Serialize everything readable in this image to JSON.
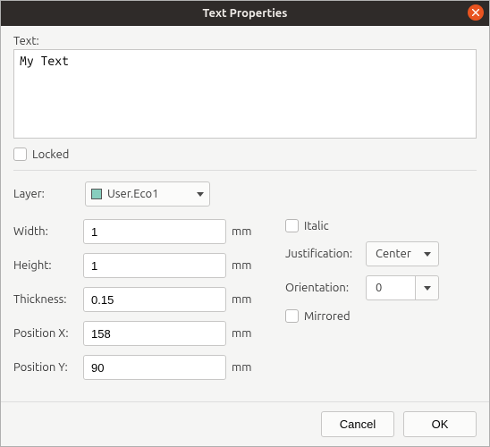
{
  "window": {
    "title": "Text Properties"
  },
  "text": {
    "label": "Text:",
    "value": "My Text"
  },
  "locked": {
    "label": "Locked"
  },
  "layer": {
    "label": "Layer:",
    "value": "User.Eco1",
    "swatch": "#87cebe"
  },
  "fields": {
    "width": {
      "label": "Width:",
      "value": "1",
      "unit": "mm"
    },
    "height": {
      "label": "Height:",
      "value": "1",
      "unit": "mm"
    },
    "thickness": {
      "label": "Thickness:",
      "value": "0.15",
      "unit": "mm"
    },
    "posx": {
      "label": "Position X:",
      "value": "158",
      "unit": "mm"
    },
    "posy": {
      "label": "Position Y:",
      "value": "90",
      "unit": "mm"
    }
  },
  "italic": {
    "label": "Italic"
  },
  "justify": {
    "label": "Justification:",
    "value": "Center"
  },
  "orient": {
    "label": "Orientation:",
    "value": "0"
  },
  "mirrored": {
    "label": "Mirrored"
  },
  "buttons": {
    "cancel": "Cancel",
    "ok": "OK"
  }
}
